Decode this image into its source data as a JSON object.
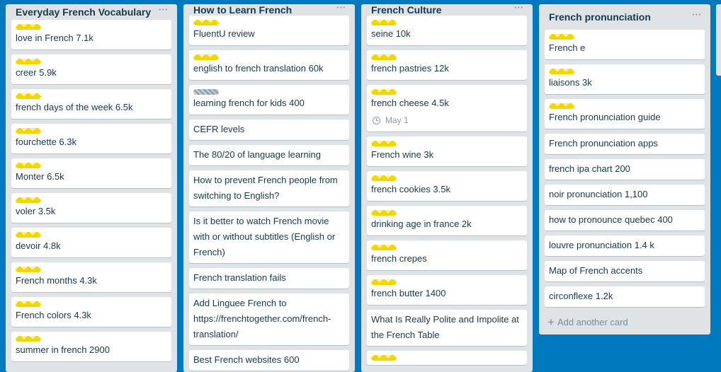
{
  "lists": [
    {
      "title": "Everyday French Vocabulary",
      "menu_icon": "more-horizontal-icon",
      "cards": [
        {
          "text": "love in French 7.1k",
          "label": "yellow"
        },
        {
          "text": "creer 5.9k",
          "label": "yellow"
        },
        {
          "text": "french days of the week 6.5k",
          "label": "yellow"
        },
        {
          "text": "fourchette 6.3k",
          "label": "yellow"
        },
        {
          "text": "Monter 6.5k",
          "label": "yellow"
        },
        {
          "text": "voler 3.5k",
          "label": "yellow"
        },
        {
          "text": "devoir 4.8k",
          "label": "yellow"
        },
        {
          "text": "French months 4.3k",
          "label": "yellow"
        },
        {
          "text": "French colors 4.3k",
          "label": "yellow"
        },
        {
          "text": "summer in french 2900",
          "label": "yellow"
        }
      ]
    },
    {
      "title": "How to Learn French",
      "menu_icon": "more-horizontal-icon",
      "cards": [
        {
          "text": "FluentU review",
          "label": "yellow"
        },
        {
          "text": "english to french translation 60k",
          "label": "yellow"
        },
        {
          "text": "learning french for kids 400",
          "label": "grey"
        },
        {
          "text": "CEFR levels"
        },
        {
          "text": "The 80/20 of language learning"
        },
        {
          "text": "How to prevent French people from switching to English?"
        },
        {
          "text": "Is it better to watch French movie with or without subtitles (English or French)"
        },
        {
          "text": "French translation fails"
        },
        {
          "text": "Add Linguee French to https://frenchtogether.com/french-translation/"
        },
        {
          "text": "Best French websites 600"
        }
      ]
    },
    {
      "title": "French Culture",
      "menu_icon": "more-horizontal-icon",
      "cards": [
        {
          "text": "seine 10k",
          "label": "yellow"
        },
        {
          "text": "french pastries 12k",
          "label": "yellow"
        },
        {
          "text": "french cheese 4.5k",
          "label": "yellow",
          "due": "May 1"
        },
        {
          "text": "French wine 3k",
          "label": "yellow"
        },
        {
          "text": "french cookies 3.5k",
          "label": "yellow"
        },
        {
          "text": "drinking age in france 2k",
          "label": "yellow"
        },
        {
          "text": "french crepes",
          "label": "yellow"
        },
        {
          "text": "french butter 1400",
          "label": "yellow"
        },
        {
          "text": "What Is Really Polite and Impolite at the French Table"
        },
        {
          "text": "",
          "label": "yellow"
        }
      ]
    },
    {
      "title": "French pronunciation",
      "menu_icon": "more-horizontal-icon",
      "cards": [
        {
          "text": "French e",
          "label": "yellow"
        },
        {
          "text": "liaisons 3k",
          "label": "yellow"
        },
        {
          "text": "French pronunciation guide",
          "label": "yellow"
        },
        {
          "text": "French pronunciation apps"
        },
        {
          "text": "french ipa chart 200"
        },
        {
          "text": "noir pronunciation 1,100"
        },
        {
          "text": "how to pronounce quebec 400"
        },
        {
          "text": "louvre pronunciation 1.4 k"
        },
        {
          "text": "Map of French accents"
        },
        {
          "text": "circonflexe 1.2k"
        }
      ],
      "add_card_label": "Add another card"
    }
  ],
  "colors": {
    "board_background": "#0079bf",
    "list_background": "#dfe3e6",
    "label_yellow": "#f2d600",
    "text": "#17394d"
  }
}
